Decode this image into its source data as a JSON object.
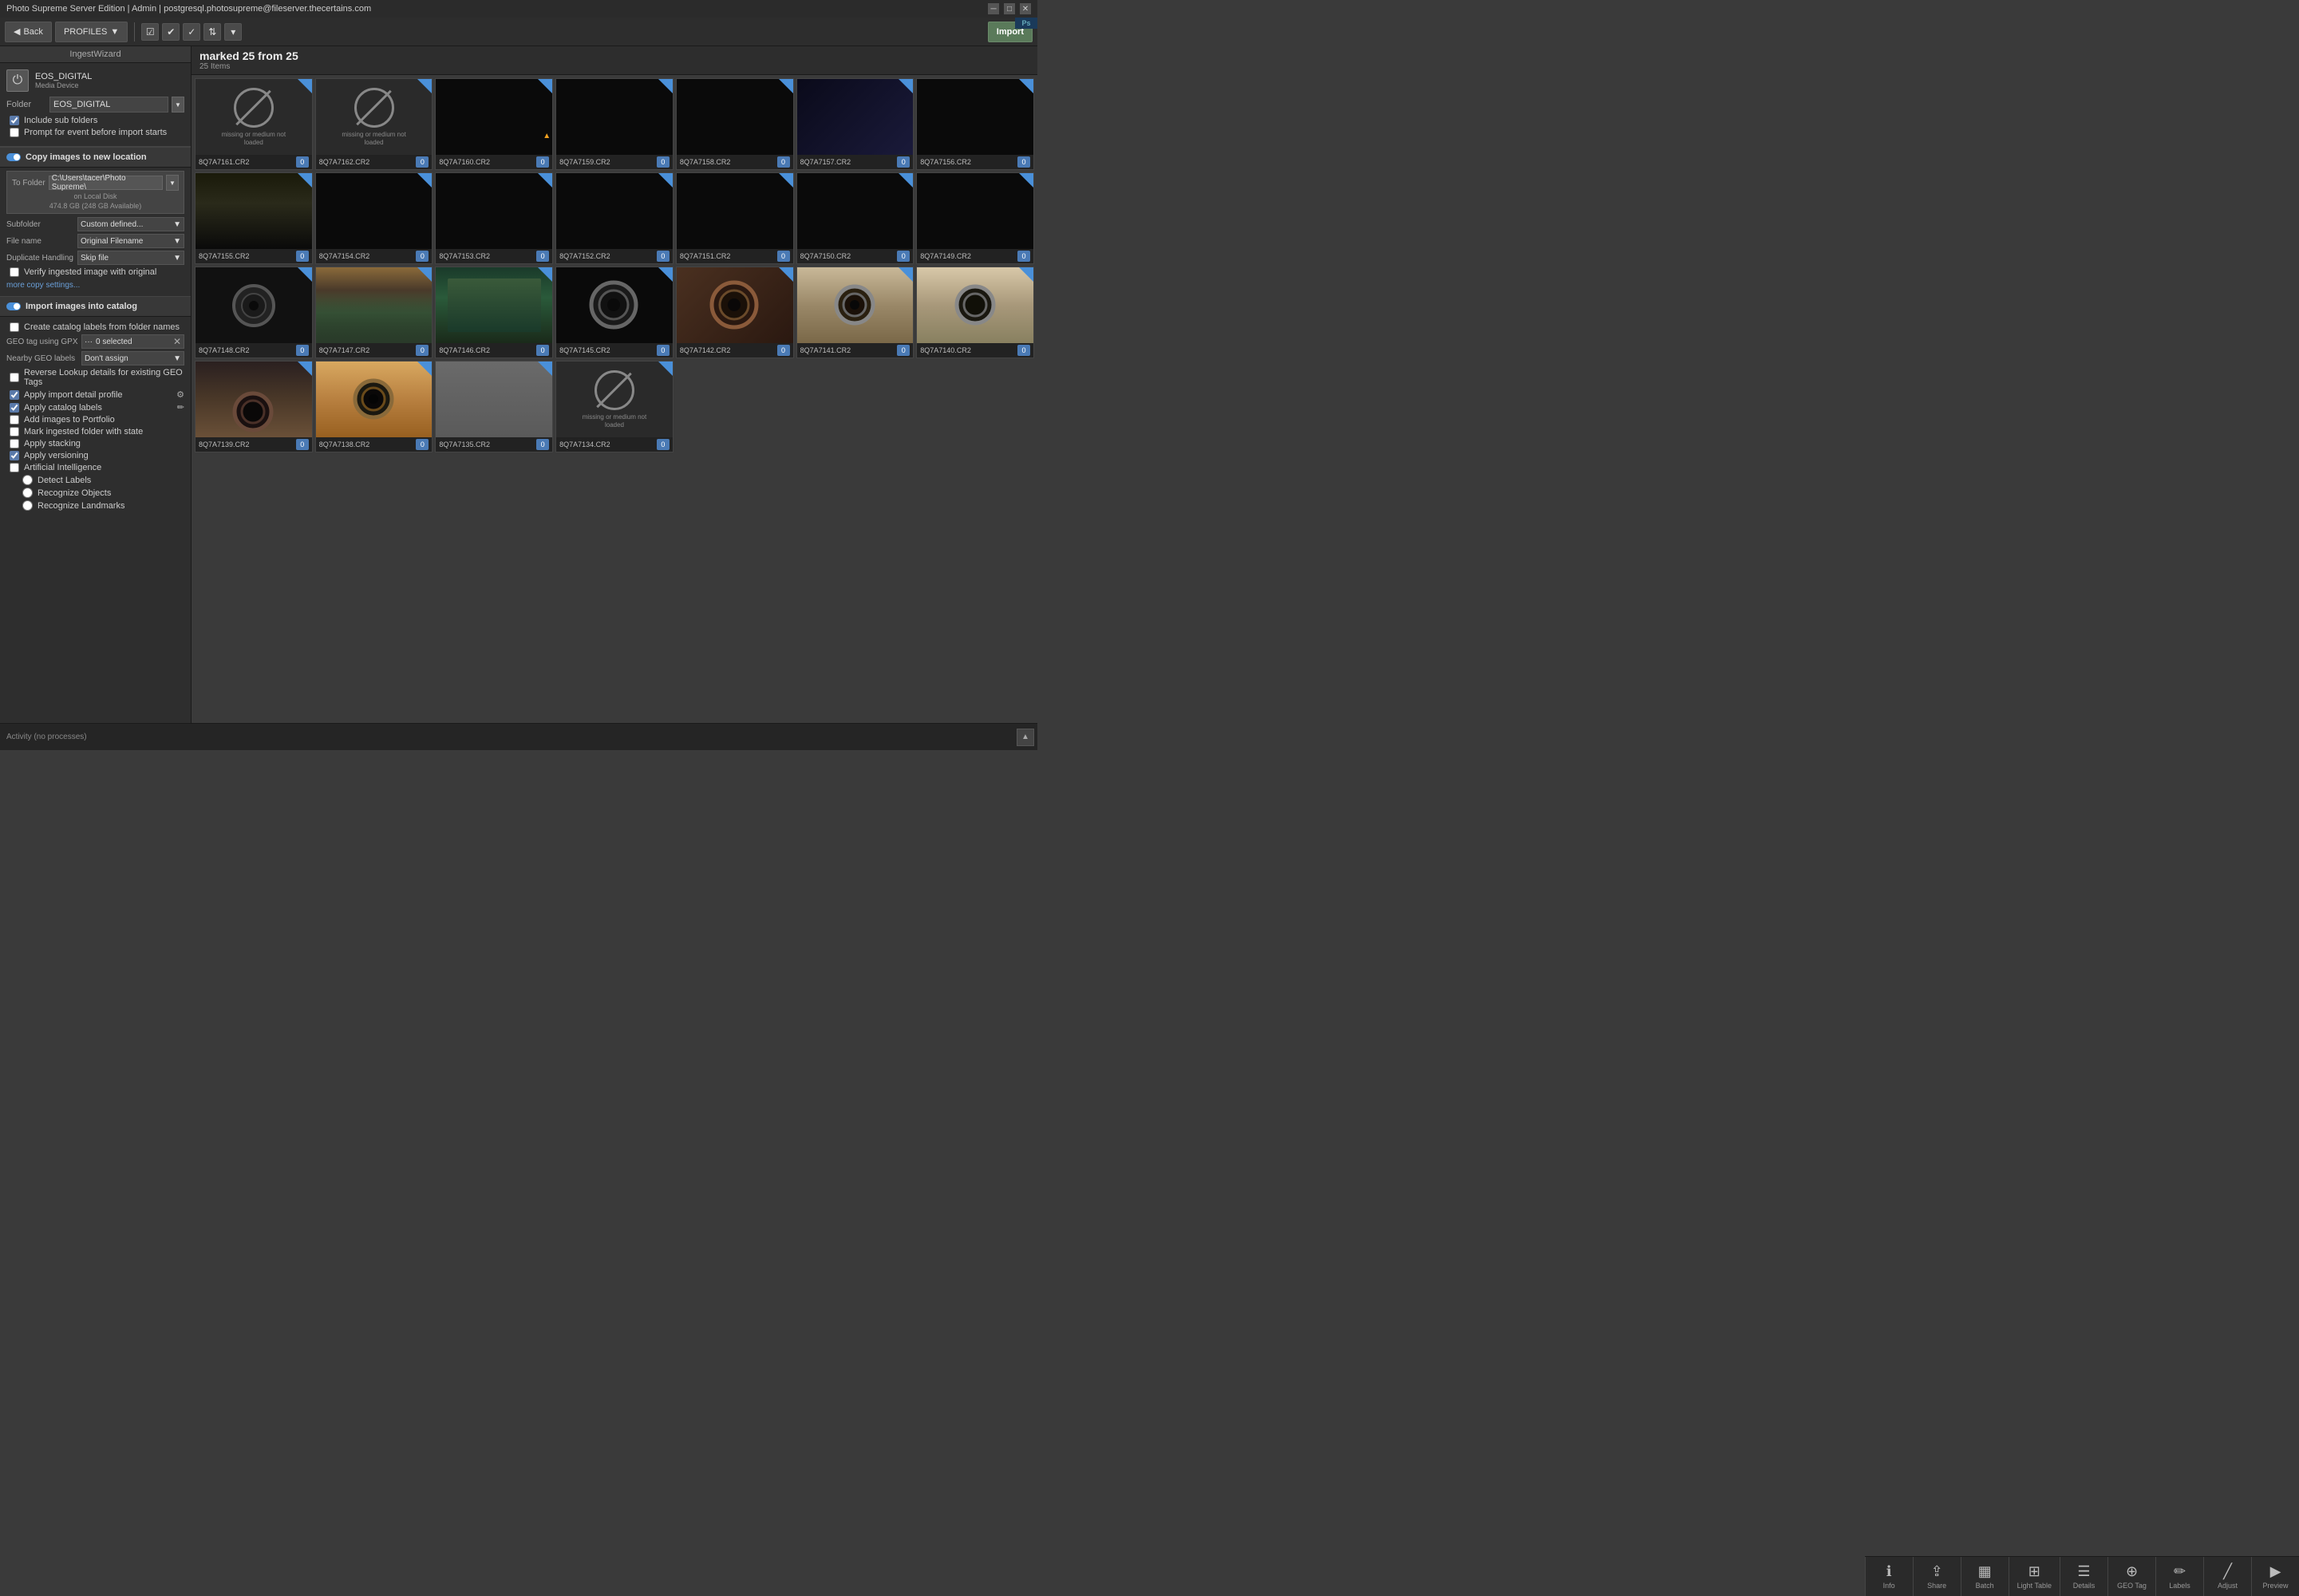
{
  "titlebar": {
    "title": "Photo Supreme Server Edition | Admin | postgresql.photosupreme@fileserver.thecertains.com",
    "controls": [
      "minimize",
      "maximize",
      "close"
    ]
  },
  "toolbar": {
    "back_label": "Back",
    "profiles_label": "PROFILES",
    "import_label": "Import",
    "photoshop_label": "Photoshop"
  },
  "sidebar": {
    "ingest_wizard": "IngestWizard",
    "device": {
      "name": "EOS_DIGITAL",
      "type": "Media Device",
      "folder_label": "Folder",
      "folder_value": "EOS_DIGITAL"
    },
    "checkboxes": {
      "include_sub": "Include sub folders",
      "prompt_event": "Prompt for event before import starts"
    },
    "copy_section": {
      "title": "Copy images to new location",
      "enabled": true,
      "to_folder_label": "To Folder",
      "to_folder_value": "C:\\Users\\tacer\\Photo Supreme\\",
      "on_disk": "on Local Disk",
      "disk_size": "474.8 GB (248 GB Available)",
      "subfolder_label": "Subfolder",
      "subfolder_value": "Custom defined...",
      "filename_label": "File name",
      "filename_value": "Original Filename",
      "dup_label": "Duplicate Handling",
      "dup_value": "Skip file",
      "verify_label": "Verify ingested image with original",
      "verify_checked": false,
      "more_settings": "more copy settings..."
    },
    "import_section": {
      "title": "Import images into catalog",
      "enabled": true,
      "create_labels": "Create catalog labels from folder names",
      "create_checked": false,
      "geo_label": "GEO tag using GPX",
      "geo_selected": "0 selected",
      "nearby_label": "Nearby GEO labels",
      "nearby_value": "Don't assign",
      "reverse_label": "Reverse Lookup details for existing GEO Tags",
      "reverse_checked": false,
      "apply_detail": "Apply import detail profile",
      "apply_detail_checked": true,
      "apply_catalog": "Apply catalog labels",
      "apply_catalog_checked": true,
      "add_portfolio": "Add images to Portfolio",
      "add_portfolio_checked": false,
      "mark_ingested": "Mark ingested folder with state",
      "mark_checked": false,
      "apply_stacking": "Apply stacking",
      "stacking_checked": false,
      "apply_versioning": "Apply versioning",
      "versioning_checked": true,
      "ai_label": "Artificial Intelligence",
      "ai_checked": false,
      "detect_labels": "Detect Labels",
      "recognize_objects": "Recognize Objects",
      "recognize_landmarks": "Recognize Landmarks"
    }
  },
  "grid": {
    "title": "marked 25 from 25",
    "subtitle": "25 Items",
    "images": [
      {
        "name": "8Q7A7161.CR2",
        "badge": "0",
        "type": "missing",
        "warning": false
      },
      {
        "name": "8Q7A7162.CR2",
        "badge": "0",
        "type": "missing",
        "warning": false
      },
      {
        "name": "8Q7A7160.CR2",
        "badge": "0",
        "type": "dark",
        "warning": true
      },
      {
        "name": "8Q7A7159.CR2",
        "badge": "0",
        "type": "dark",
        "warning": false
      },
      {
        "name": "8Q7A7158.CR2",
        "badge": "0",
        "type": "dark",
        "warning": false
      },
      {
        "name": "8Q7A7157.CR2",
        "badge": "0",
        "type": "dark-blue",
        "warning": false
      },
      {
        "name": "8Q7A7156.CR2",
        "badge": "0",
        "type": "dark",
        "warning": false
      },
      {
        "name": "8Q7A7155.CR2",
        "badge": "0",
        "type": "dark-image",
        "warning": false
      },
      {
        "name": "8Q7A7154.CR2",
        "badge": "0",
        "type": "dark",
        "warning": false
      },
      {
        "name": "8Q7A7153.CR2",
        "badge": "0",
        "type": "dark",
        "warning": false
      },
      {
        "name": "8Q7A7152.CR2",
        "badge": "0",
        "type": "dark",
        "warning": false
      },
      {
        "name": "8Q7A7151.CR2",
        "badge": "0",
        "type": "dark",
        "warning": false
      },
      {
        "name": "8Q7A7150.CR2",
        "badge": "0",
        "type": "dark",
        "warning": false
      },
      {
        "name": "8Q7A7149.CR2",
        "badge": "0",
        "type": "dark",
        "warning": false
      },
      {
        "name": "8Q7A7148.CR2",
        "badge": "0",
        "type": "dark-lens",
        "warning": false
      },
      {
        "name": "8Q7A7147.CR2",
        "badge": "0",
        "type": "crowd",
        "warning": false
      },
      {
        "name": "8Q7A7146.CR2",
        "badge": "0",
        "type": "crowd2",
        "warning": false
      },
      {
        "name": "8Q7A7145.CR2",
        "badge": "0",
        "type": "lens-dark",
        "warning": false
      },
      {
        "name": "8Q7A7142.CR2",
        "badge": "0",
        "type": "lens-brown",
        "warning": false
      },
      {
        "name": "8Q7A7141.CR2",
        "badge": "0",
        "type": "lens-room",
        "warning": false
      },
      {
        "name": "8Q7A7140.CR2",
        "badge": "0",
        "type": "lens-room2",
        "warning": false
      },
      {
        "name": "8Q7A7139.CR2",
        "badge": "0",
        "type": "lens-floor",
        "warning": false
      },
      {
        "name": "8Q7A7138.CR2",
        "badge": "0",
        "type": "lens-table",
        "warning": false
      },
      {
        "name": "8Q7A7135.CR2",
        "badge": "0",
        "type": "gray-flat",
        "warning": false
      },
      {
        "name": "8Q7A7134.CR2",
        "badge": "0",
        "type": "missing",
        "warning": false
      }
    ]
  },
  "statusbar": {
    "text": "Activity (no processes)"
  },
  "bottom_tools": [
    {
      "id": "info",
      "label": "Info",
      "icon": "ℹ"
    },
    {
      "id": "share",
      "label": "Share",
      "icon": "⇪"
    },
    {
      "id": "batch",
      "label": "Batch",
      "icon": "▦"
    },
    {
      "id": "light-table",
      "label": "Light Table",
      "icon": "⊞"
    },
    {
      "id": "details",
      "label": "Details",
      "icon": "☰"
    },
    {
      "id": "geo-tag",
      "label": "GEO Tag",
      "icon": "⊕"
    },
    {
      "id": "labels",
      "label": "Labels",
      "icon": "✏"
    },
    {
      "id": "adjust",
      "label": "Adjust",
      "icon": "╱"
    },
    {
      "id": "preview",
      "label": "Preview",
      "icon": "▶"
    }
  ]
}
